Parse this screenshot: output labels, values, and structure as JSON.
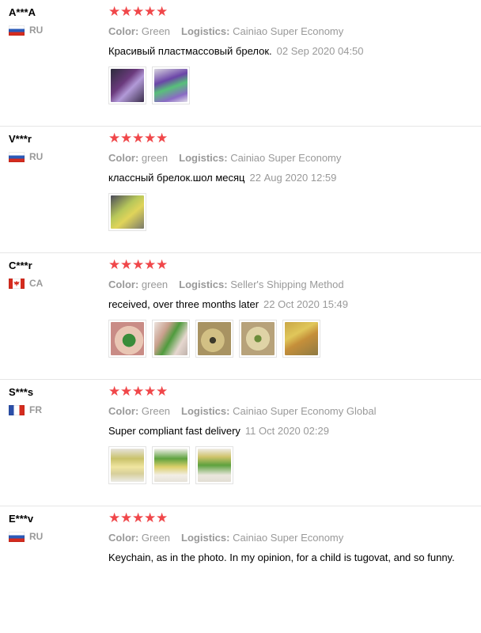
{
  "reviews": [
    {
      "user": "A***A",
      "country": "RU",
      "flag": "ru",
      "rating": 5,
      "color_label": "Color:",
      "color_value": "Green",
      "logistics_label": "Logistics:",
      "logistics_value": "Cainiao Super Economy",
      "text": "Красивый пластмассовый брелок.",
      "date": "02 Sep 2020 04:50",
      "photos": [
        "p-hand1",
        "p-hand2"
      ]
    },
    {
      "user": "V***r",
      "country": "RU",
      "flag": "ru",
      "rating": 5,
      "color_label": "Color:",
      "color_value": "green",
      "logistics_label": "Logistics:",
      "logistics_value": "Cainiao Super Economy",
      "text": "классный брелок.шол месяц",
      "date": "22 Aug 2020 12:59",
      "photos": [
        "p-pack"
      ]
    },
    {
      "user": "C***r",
      "country": "CA",
      "flag": "ca",
      "rating": 5,
      "color_label": "Color:",
      "color_value": "green",
      "logistics_label": "Logistics:",
      "logistics_value": "Seller's Shipping Method",
      "text": "received, over three months later",
      "date": "22 Oct 2020 15:49",
      "photos": [
        "p-green1",
        "p-green2",
        "p-tan1",
        "p-tan2",
        "p-tan3"
      ]
    },
    {
      "user": "S***s",
      "country": "FR",
      "flag": "fr",
      "rating": 5,
      "color_label": "Color:",
      "color_value": "Green",
      "logistics_label": "Logistics:",
      "logistics_value": "Cainiao Super Economy Global",
      "text": "Super compliant fast delivery",
      "date": "11 Oct 2020 02:29",
      "photos": [
        "p-clip1",
        "p-clip2",
        "p-clip3"
      ]
    },
    {
      "user": "E***v",
      "country": "RU",
      "flag": "ru",
      "rating": 5,
      "color_label": "Color:",
      "color_value": "Green",
      "logistics_label": "Logistics:",
      "logistics_value": "Cainiao Super Economy",
      "text": "Keychain, as in the photo. In my opinion, for a child is tugovat, and so funny. ",
      "date": "",
      "photos": []
    }
  ],
  "colors": {
    "star": "#f0474a",
    "muted": "#999999",
    "text": "#000000"
  },
  "icons": {
    "star": "star-icon"
  }
}
